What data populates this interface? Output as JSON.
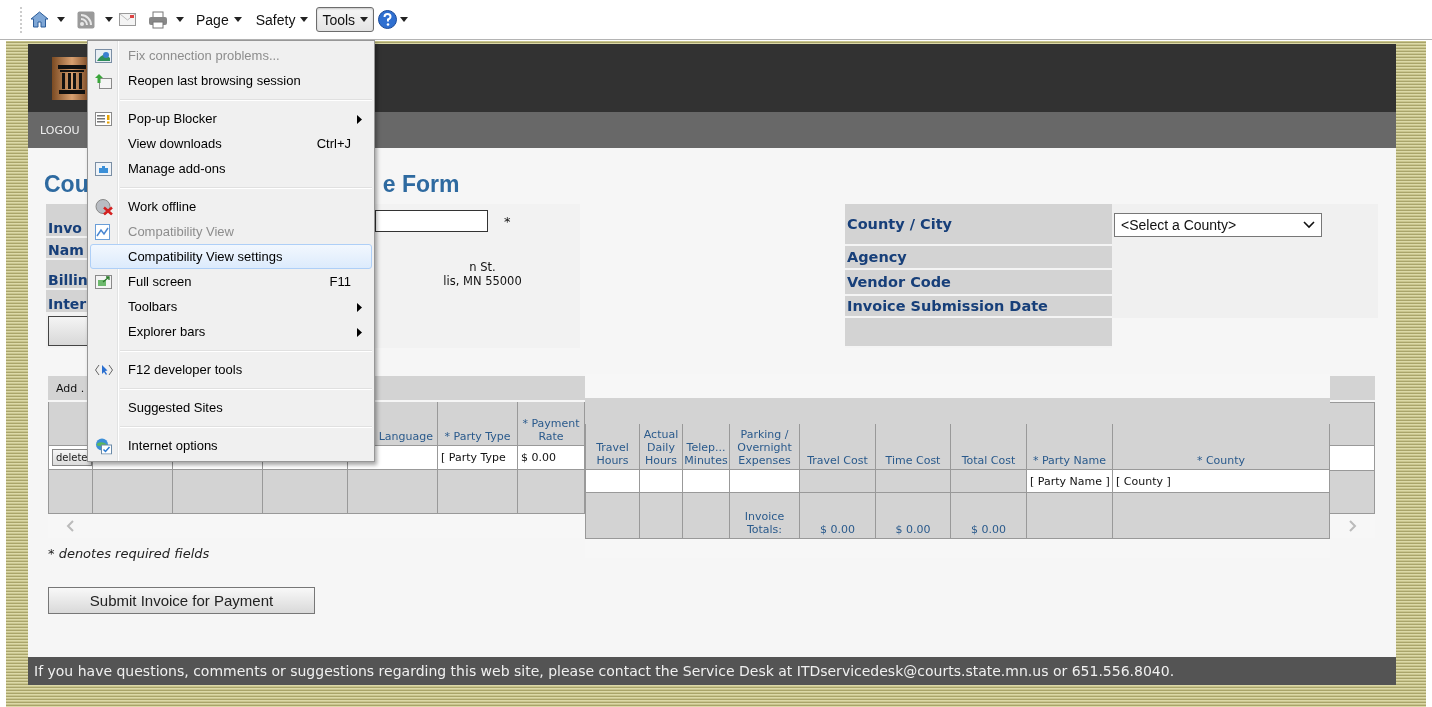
{
  "toolbar": {
    "buttons": [
      {
        "label": "Page",
        "selected": false
      },
      {
        "label": "Safety",
        "selected": false
      },
      {
        "label": "Tools",
        "selected": true
      }
    ]
  },
  "header": {
    "nav_link": "LOGOU"
  },
  "form": {
    "title_start": "Cou",
    "title_end": "e Form",
    "invoice_panel": {
      "labels": [
        "Invo",
        "Nam",
        "Billin",
        "Inter"
      ],
      "required_mark": "*",
      "address_lines": [
        "n St.",
        "lis, MN 55000"
      ]
    },
    "county_panel": {
      "labels": [
        "County / City",
        "Agency",
        "Vendor Code",
        "Invoice Submission Date"
      ],
      "county_select": "<Select a County>"
    },
    "left_table": {
      "add_label": "Add .",
      "headers": [
        "Language",
        "* Party Type",
        "* Payment Rate"
      ],
      "delete_button": "delete",
      "party_type": "[ Party Type",
      "payment_rate": "$ 0.00"
    },
    "right_table": {
      "columns": [
        "Travel\nHours",
        "Actual\nDaily\nHours",
        "Telep...\nMinutes",
        "Parking /\nOvernight\nExpenses",
        "Travel Cost",
        "Time Cost",
        "Total Cost",
        "* Party Name",
        "* County"
      ],
      "party_name": "[ Party Name ]",
      "county": "[ County ]",
      "totals_label": "Invoice\nTotals:",
      "travel_cost_total": "$ 0.00",
      "time_cost_total": "$ 0.00",
      "total_cost_total": "$ 0.00"
    },
    "required_note": "* denotes required fields",
    "submit_button": "Submit Invoice for Payment"
  },
  "footer": "If you have questions, comments or suggestions regarding this web site, please contact the Service Desk at ITDservicedesk@courts.state.mn.us or 651.556.8040.",
  "tools_menu": {
    "items": [
      {
        "kind": "item",
        "label": "Fix connection problems...",
        "disabled": true,
        "selected": false,
        "submenu": false
      },
      {
        "kind": "item",
        "label": "Reopen last browsing session",
        "disabled": false,
        "selected": false,
        "submenu": false
      },
      {
        "kind": "separator"
      },
      {
        "kind": "item",
        "label": "Pop-up Blocker",
        "disabled": false,
        "selected": false,
        "submenu": true
      },
      {
        "kind": "item",
        "label": "View downloads",
        "shortcut": "Ctrl+J",
        "disabled": false,
        "selected": false,
        "submenu": false
      },
      {
        "kind": "item",
        "label": "Manage add-ons",
        "disabled": false,
        "selected": false,
        "submenu": false
      },
      {
        "kind": "separator"
      },
      {
        "kind": "item",
        "label": "Work offline",
        "disabled": false,
        "selected": false,
        "submenu": false
      },
      {
        "kind": "item",
        "label": "Compatibility View",
        "disabled": true,
        "selected": false,
        "submenu": false
      },
      {
        "kind": "item",
        "label": "Compatibility View settings",
        "disabled": false,
        "selected": true,
        "submenu": false
      },
      {
        "kind": "item",
        "label": "Full screen",
        "shortcut": "F11",
        "disabled": false,
        "selected": false,
        "submenu": false
      },
      {
        "kind": "item",
        "label": "Toolbars",
        "disabled": false,
        "selected": false,
        "submenu": true
      },
      {
        "kind": "item",
        "label": "Explorer bars",
        "disabled": false,
        "selected": false,
        "submenu": true
      },
      {
        "kind": "separator"
      },
      {
        "kind": "item",
        "label": "F12 developer tools",
        "disabled": false,
        "selected": false,
        "submenu": false
      },
      {
        "kind": "separator"
      },
      {
        "kind": "item",
        "label": "Suggested Sites",
        "disabled": false,
        "selected": false,
        "submenu": false
      },
      {
        "kind": "separator"
      },
      {
        "kind": "item",
        "label": "Internet options",
        "disabled": false,
        "selected": false,
        "submenu": false
      }
    ]
  }
}
